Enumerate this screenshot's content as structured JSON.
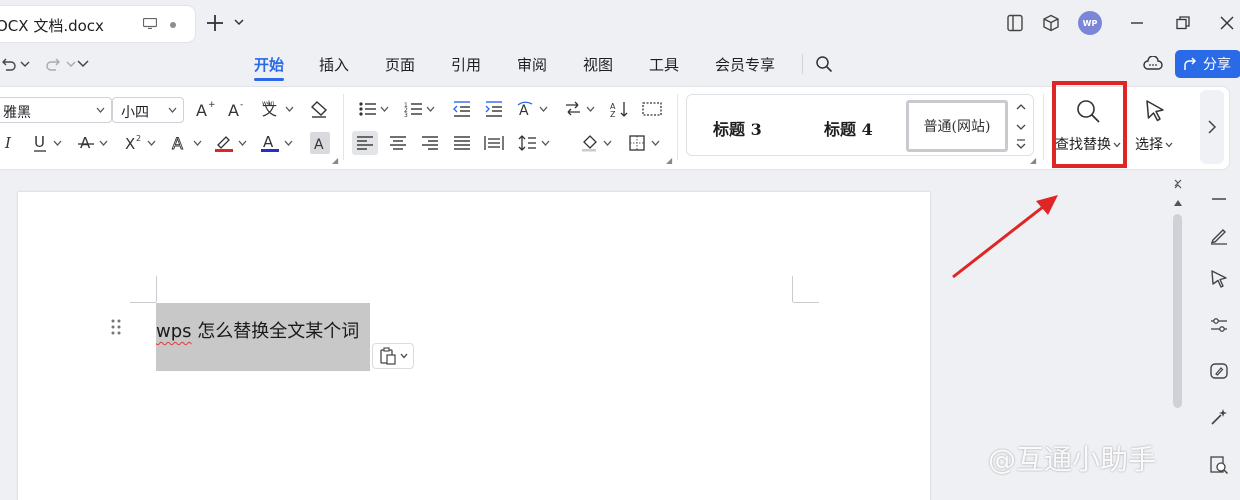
{
  "titlebar": {
    "doc_title": "OCX 文档.docx",
    "avatar_text": "WP"
  },
  "menubar": {
    "tabs": [
      {
        "label": "开始",
        "active": true
      },
      {
        "label": "插入"
      },
      {
        "label": "页面"
      },
      {
        "label": "引用"
      },
      {
        "label": "审阅"
      },
      {
        "label": "视图"
      },
      {
        "label": "工具"
      },
      {
        "label": "会员专享"
      }
    ],
    "share_label": "分享"
  },
  "ribbon": {
    "font_name": "雅黑",
    "font_size": "小四",
    "styles": {
      "heading3": "标题 3",
      "heading4": "标题 4",
      "normal_web": "普通(网站)"
    },
    "find_replace_label": "查找替换",
    "select_label": "选择"
  },
  "document": {
    "line_prefix": "wps",
    "line_rest": " 怎么替换全文某个词"
  },
  "watermark": "@互通小助手",
  "colors": {
    "accent": "#2a6ae6",
    "highlight": "#e02525",
    "selection": "#c8c8c8"
  }
}
